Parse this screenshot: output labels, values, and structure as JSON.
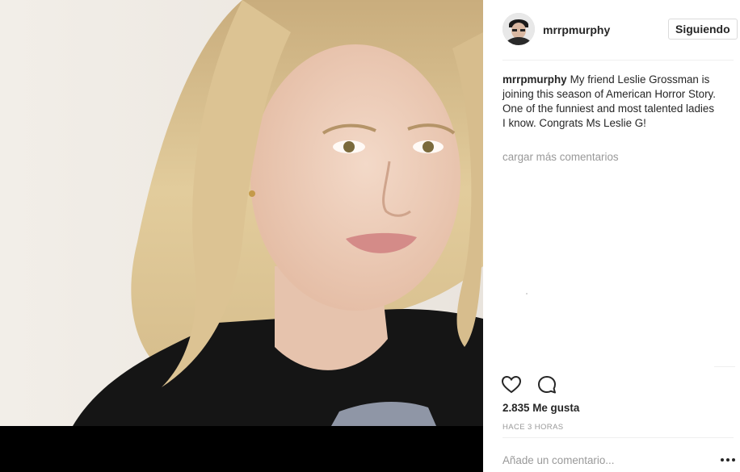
{
  "post": {
    "username": "mrrpmurphy",
    "follow_button_label": "Siguiendo",
    "caption": {
      "username": "mrrpmurphy",
      "text": "My friend Leslie Grossman is joining this season of American Horror Story. One of the funniest and most talented ladies I know. Congrats Ms Leslie G!"
    },
    "load_more_comments_label": "cargar más comentarios",
    "likes_label": "2.835 Me gusta",
    "timestamp_label": "HACE 3 HORAS",
    "comment_placeholder": "Añade un comentario..."
  },
  "icons": {
    "like": "heart-icon",
    "comment": "comment-bubble-icon",
    "options": "ellipsis-icon"
  },
  "colors": {
    "text_primary": "#262626",
    "text_secondary": "#999999",
    "divider": "#efefef",
    "button_border": "#dbdbdb",
    "photo_background": "#efebe4",
    "letterbox": "#000000"
  }
}
